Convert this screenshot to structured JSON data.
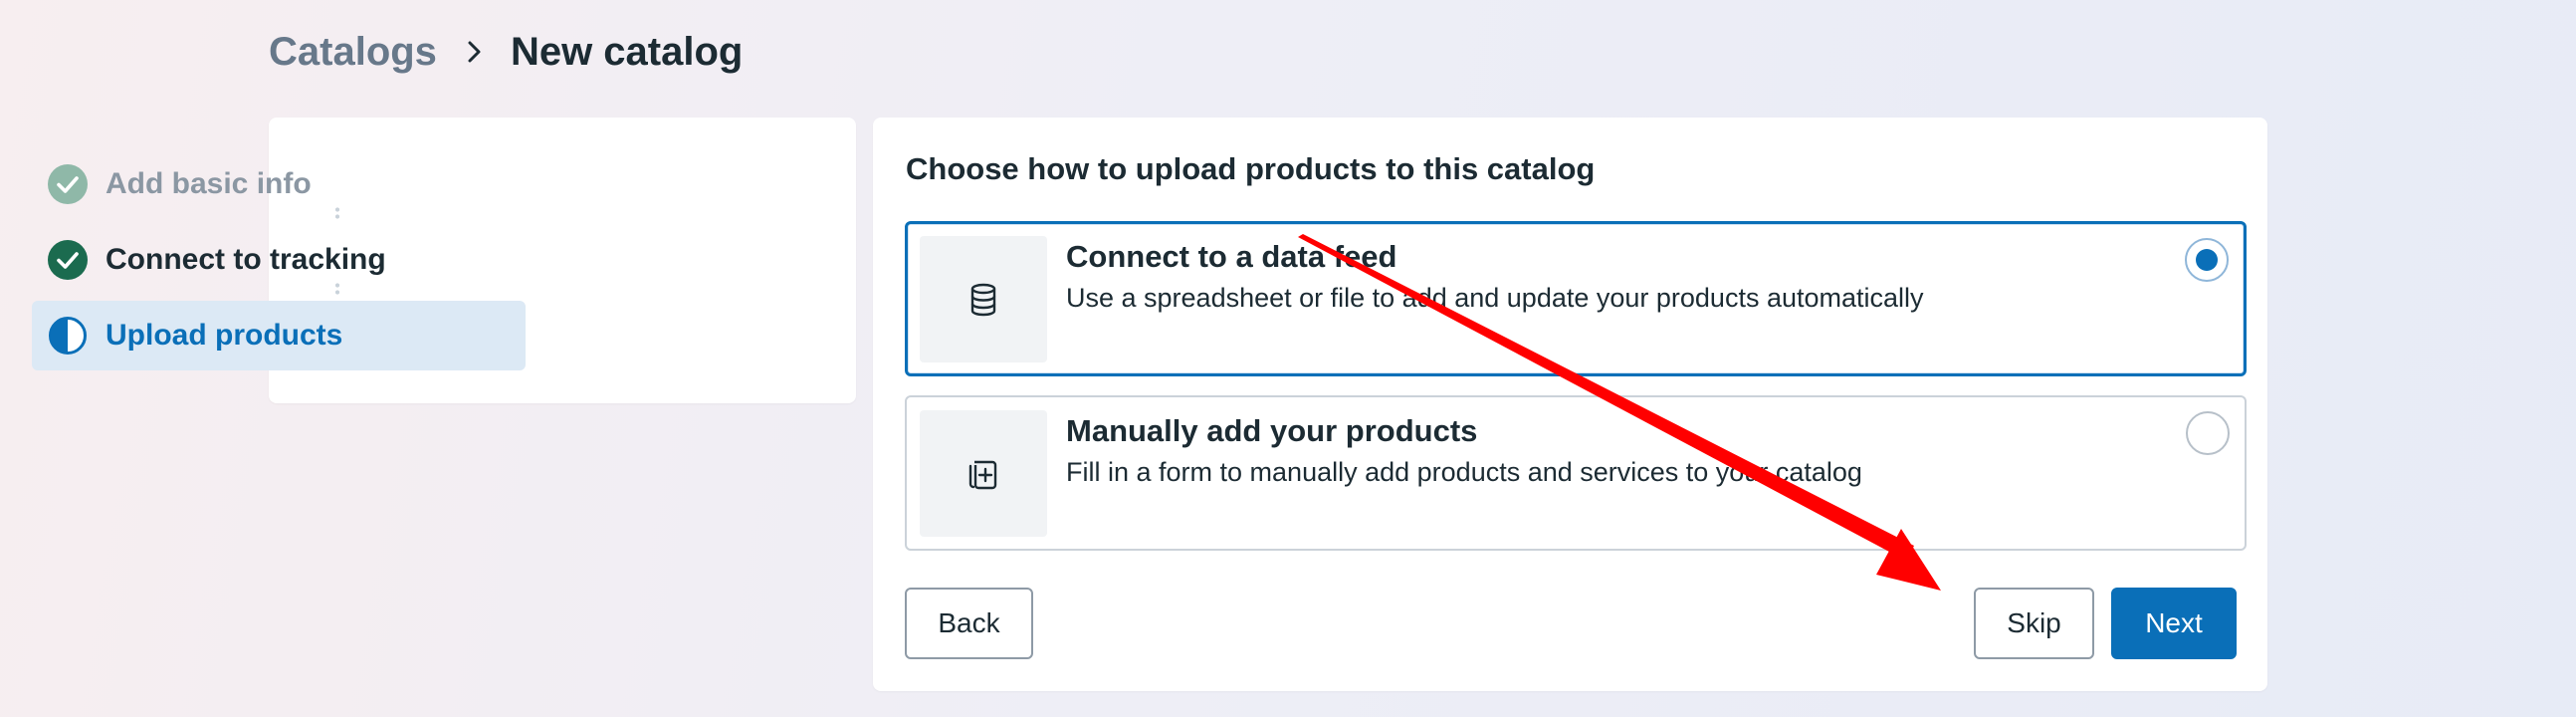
{
  "breadcrumb": {
    "parent": "Catalogs",
    "current": "New catalog",
    "separator_icon": "chevron-right-icon"
  },
  "steps": [
    {
      "label": "Add basic info",
      "status": "completed",
      "icon": "check-circle-icon"
    },
    {
      "label": "Connect to tracking",
      "status": "completed",
      "icon": "check-circle-icon"
    },
    {
      "label": "Upload products",
      "status": "in-progress",
      "icon": "half-circle-icon"
    }
  ],
  "main": {
    "title": "Choose how to upload products to this catalog",
    "options": [
      {
        "title": "Connect to a data feed",
        "description": "Use a spreadsheet or file to add and update your products automatically",
        "icon": "database-icon",
        "selected": true
      },
      {
        "title": "Manually add your products",
        "description": "Fill in a form to manually add products and services to your catalog",
        "icon": "add-product-icon",
        "selected": false
      }
    ]
  },
  "buttons": {
    "back": "Back",
    "skip": "Skip",
    "next": "Next"
  },
  "colors": {
    "accent": "#0a6fb8",
    "completed_step": "#1b6b4f",
    "annotation_arrow": "#ff0000"
  }
}
